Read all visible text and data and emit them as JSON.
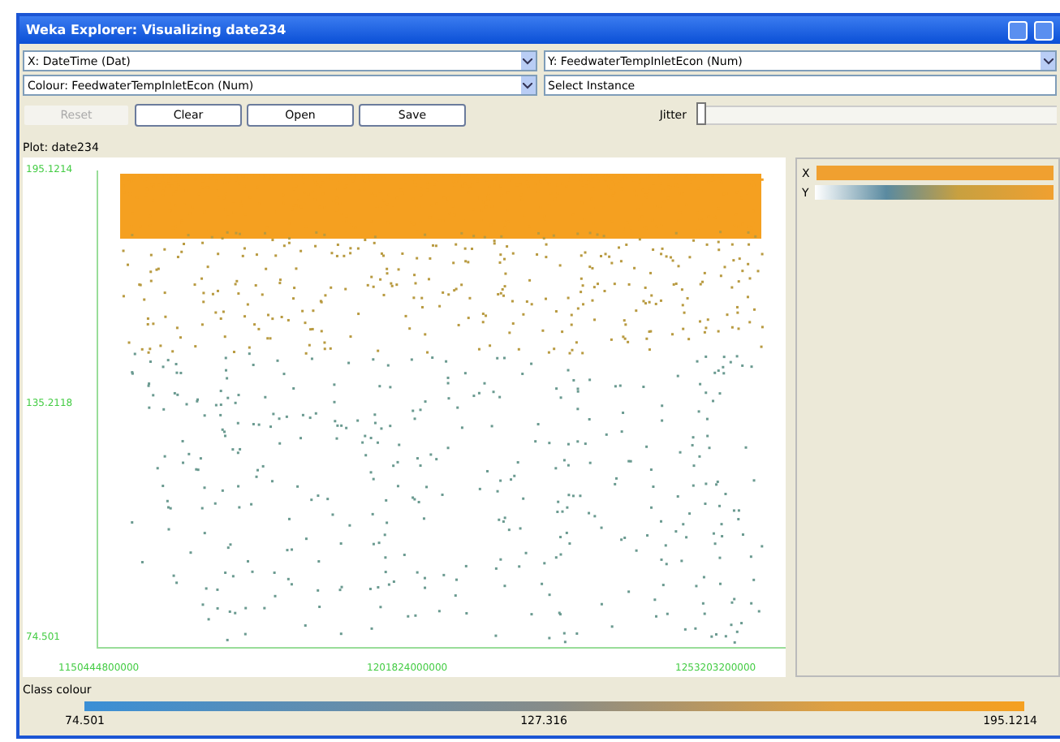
{
  "window": {
    "title": "Weka Explorer: Visualizing date234"
  },
  "selectors": [
    {
      "value": "X: DateTime (Dat)"
    },
    {
      "value": "Y: FeedwaterTempInletEcon (Num)"
    },
    {
      "value": "Colour: FeedwaterTempInletEcon (Num)"
    },
    {
      "value": "Select Instance"
    }
  ],
  "buttons": [
    {
      "label": "Reset",
      "disabled": true
    },
    {
      "label": "Clear",
      "disabled": false
    },
    {
      "label": "Open",
      "disabled": false
    },
    {
      "label": "Save",
      "disabled": false
    }
  ],
  "jitter": {
    "label": "Jitter",
    "level": 0
  },
  "plot": {
    "title": "Plot: date234",
    "y_labels": [
      "195.1214",
      "135.2118",
      "74.501"
    ],
    "x_labels": [
      "1150444800000",
      "1201824000000",
      "1253203200000"
    ]
  },
  "attribute_strips": [
    {
      "label": "X"
    },
    {
      "label": "Y"
    }
  ],
  "class_colour": {
    "title": "Class colour",
    "labels": [
      "74.501",
      "127.316",
      "195.1214"
    ]
  }
}
